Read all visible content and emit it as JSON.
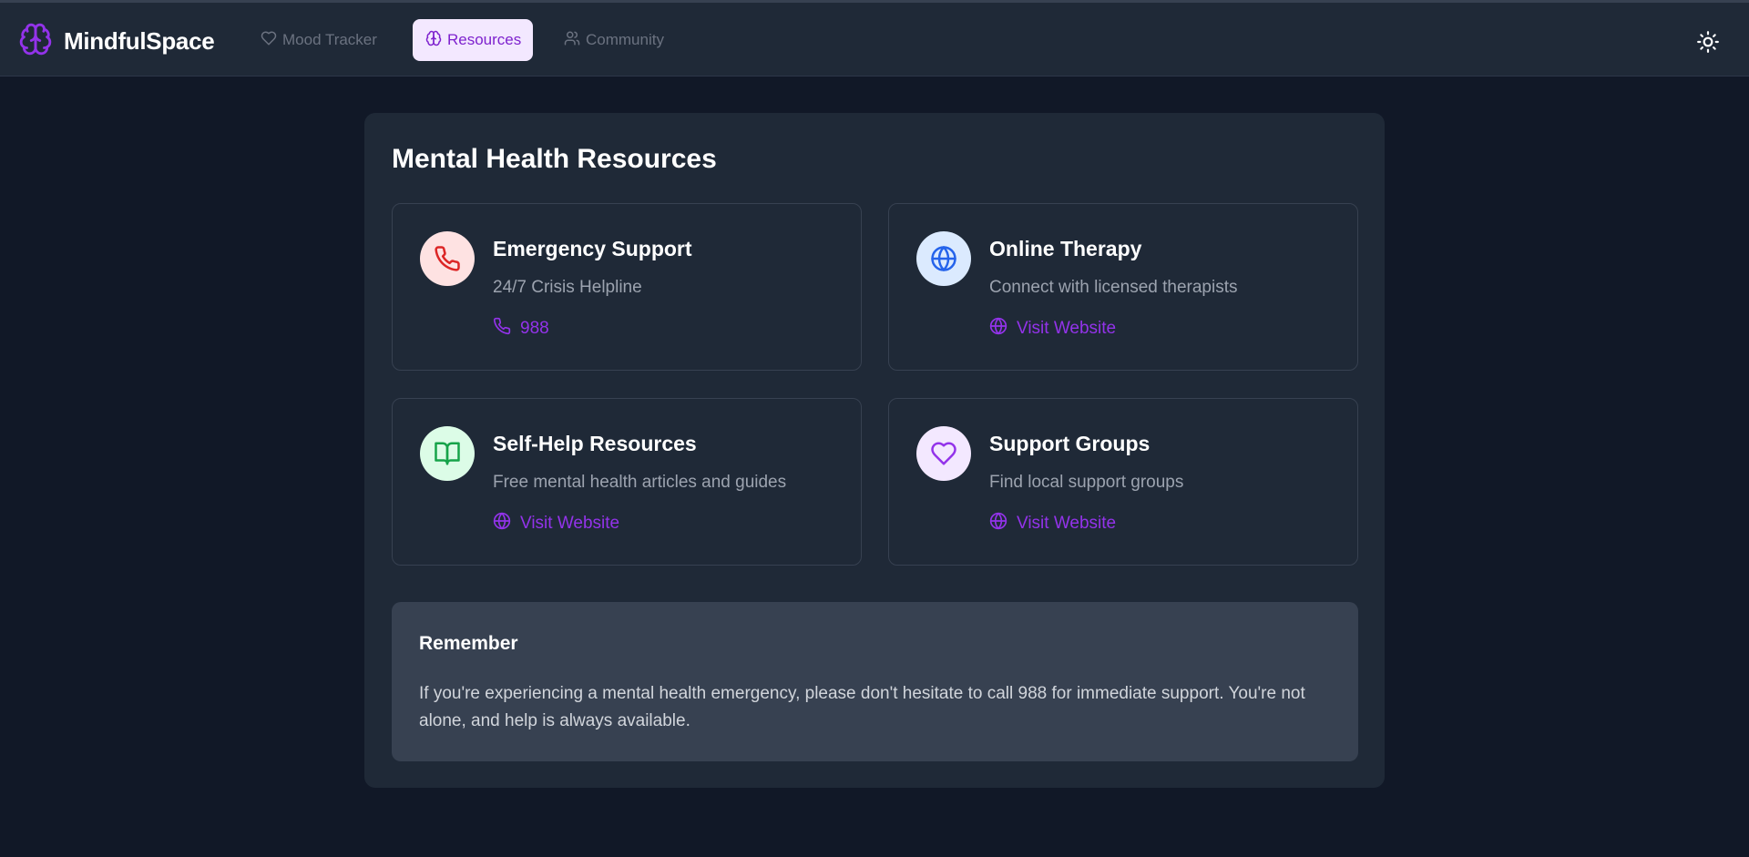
{
  "app": {
    "name": "MindfulSpace",
    "brand_icon": "brain-icon",
    "accent_color": "#9333ea"
  },
  "nav": {
    "items": [
      {
        "label": "Mood Tracker",
        "icon": "heart-icon",
        "active": false
      },
      {
        "label": "Resources",
        "icon": "brain-icon",
        "active": true
      },
      {
        "label": "Community",
        "icon": "users-icon",
        "active": false
      }
    ],
    "theme_toggle_icon": "sun-icon"
  },
  "main": {
    "title": "Mental Health Resources",
    "cards": [
      {
        "title": "Emergency Support",
        "description": "24/7 Crisis Helpline",
        "link_label": "988",
        "icon": "phone-icon",
        "link_icon": "phone-icon",
        "icon_color": "#dc2626",
        "icon_bg": "#fee2e2"
      },
      {
        "title": "Online Therapy",
        "description": "Connect with licensed therapists",
        "link_label": "Visit Website",
        "icon": "globe-icon",
        "link_icon": "globe-icon",
        "icon_color": "#2563eb",
        "icon_bg": "#dbeafe"
      },
      {
        "title": "Self-Help Resources",
        "description": "Free mental health articles and guides",
        "link_label": "Visit Website",
        "icon": "book-open-icon",
        "link_icon": "globe-icon",
        "icon_color": "#16a34a",
        "icon_bg": "#dcfce7"
      },
      {
        "title": "Support Groups",
        "description": "Find local support groups",
        "link_label": "Visit Website",
        "icon": "heart-icon",
        "link_icon": "globe-icon",
        "icon_color": "#9333ea",
        "icon_bg": "#f3e8ff"
      }
    ],
    "remember": {
      "title": "Remember",
      "text": "If you're experiencing a mental health emergency, please don't hesitate to call 988 for immediate support. You're not alone, and help is always available."
    }
  }
}
